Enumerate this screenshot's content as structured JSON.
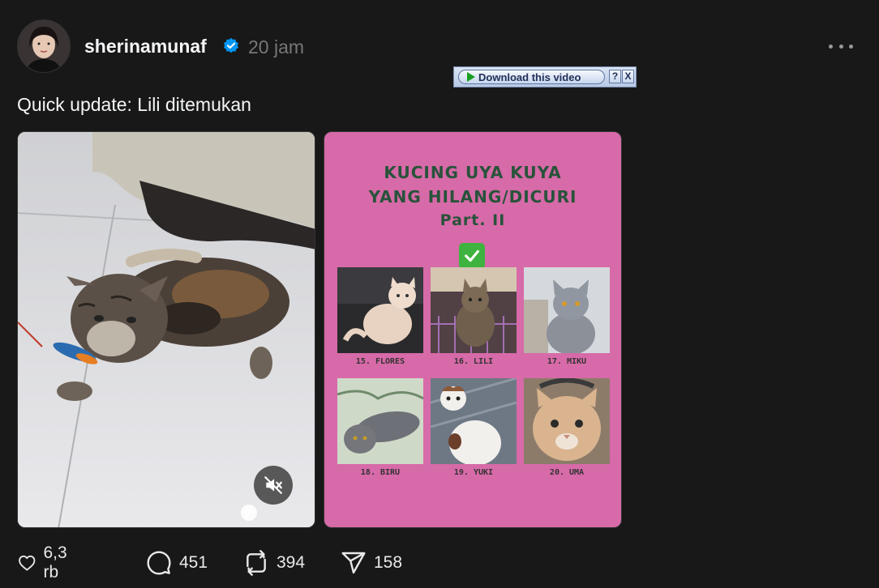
{
  "post": {
    "username": "sherinamunaf",
    "time": "20 jam",
    "caption": "Quick update: Lili ditemukan"
  },
  "download_bar": {
    "label": "Download this video",
    "help": "?",
    "close": "X"
  },
  "poster": {
    "title_line1": "KUCING UYA KUYA",
    "title_line2": "YANG HILANG/DICURI",
    "title_line3": "Part. II",
    "cats": [
      {
        "label": "15. FLORES"
      },
      {
        "label": "16. LILI"
      },
      {
        "label": "17. MIKU"
      },
      {
        "label": "18. BIRU"
      },
      {
        "label": "19. YUKI"
      },
      {
        "label": "20. UMA"
      }
    ]
  },
  "actions": {
    "likes": "6,3 rb",
    "comments": "451",
    "reposts": "394",
    "shares": "158"
  },
  "colors": {
    "background": "#181818",
    "verified": "#0095f6",
    "poster_pink": "#d76aa8",
    "poster_title": "#28533a"
  },
  "icons": [
    "verified-badge-icon",
    "more-icon",
    "mute-icon",
    "check-mark-icon",
    "heart-icon",
    "comment-icon",
    "repost-icon",
    "share-icon",
    "play-icon"
  ]
}
